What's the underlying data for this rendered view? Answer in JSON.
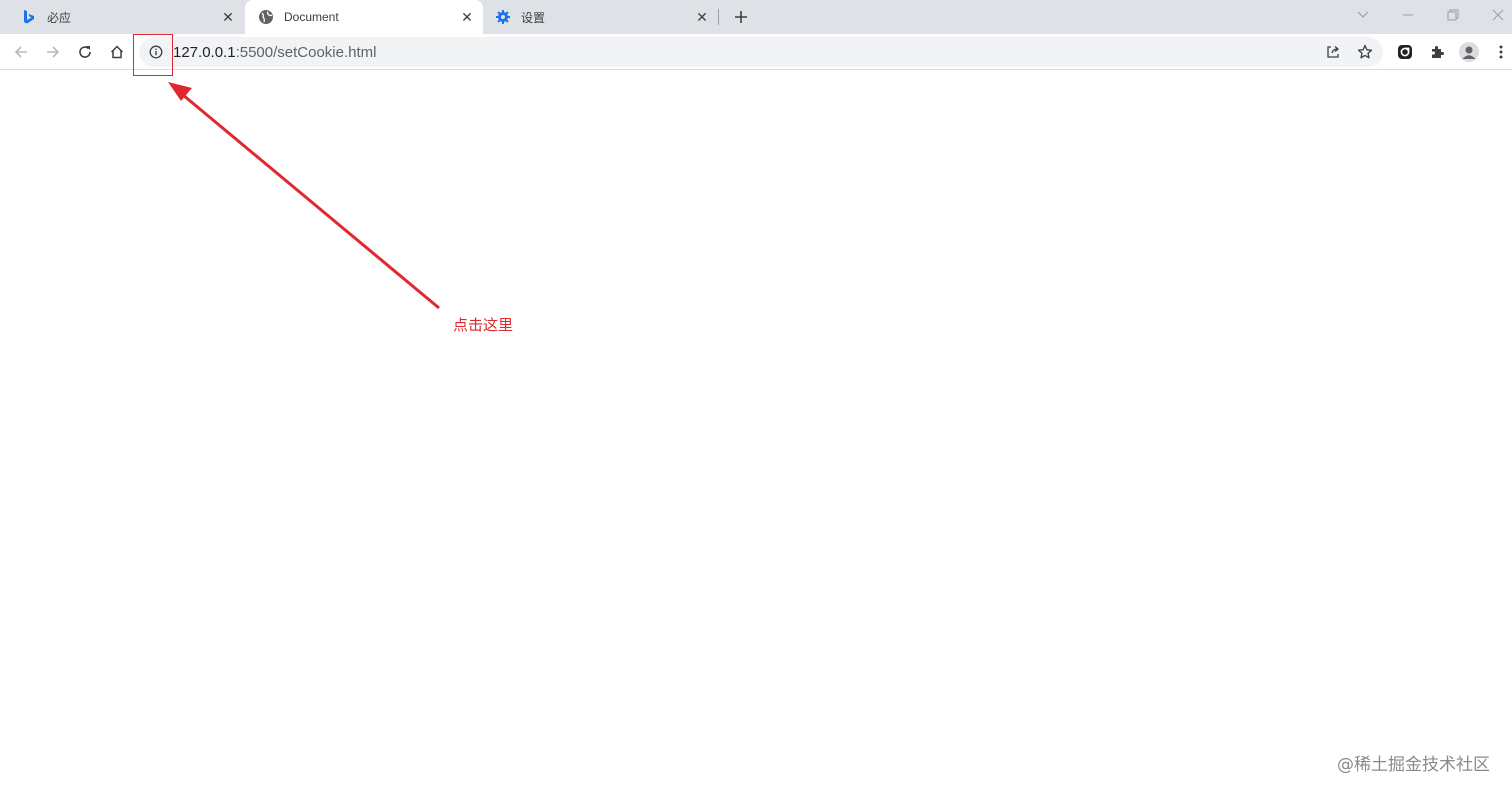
{
  "tabs": [
    {
      "title": "必应",
      "icon": "bing-icon",
      "active": false
    },
    {
      "title": "Document",
      "icon": "globe-icon",
      "active": true
    },
    {
      "title": "设置",
      "icon": "settings-gear-icon",
      "active": false
    }
  ],
  "address_bar": {
    "host": "127.0.0.1",
    "path": ":5500/setCookie.html"
  },
  "annotation": {
    "label": "点击这里",
    "color": "#e0282e"
  },
  "watermark": "@稀土掘金技术社区",
  "colors": {
    "tabstrip_bg": "#dee1e6",
    "omnibox_bg": "#f1f3f4",
    "bing_blue": "#1a73e8",
    "settings_blue": "#1a73e8"
  }
}
